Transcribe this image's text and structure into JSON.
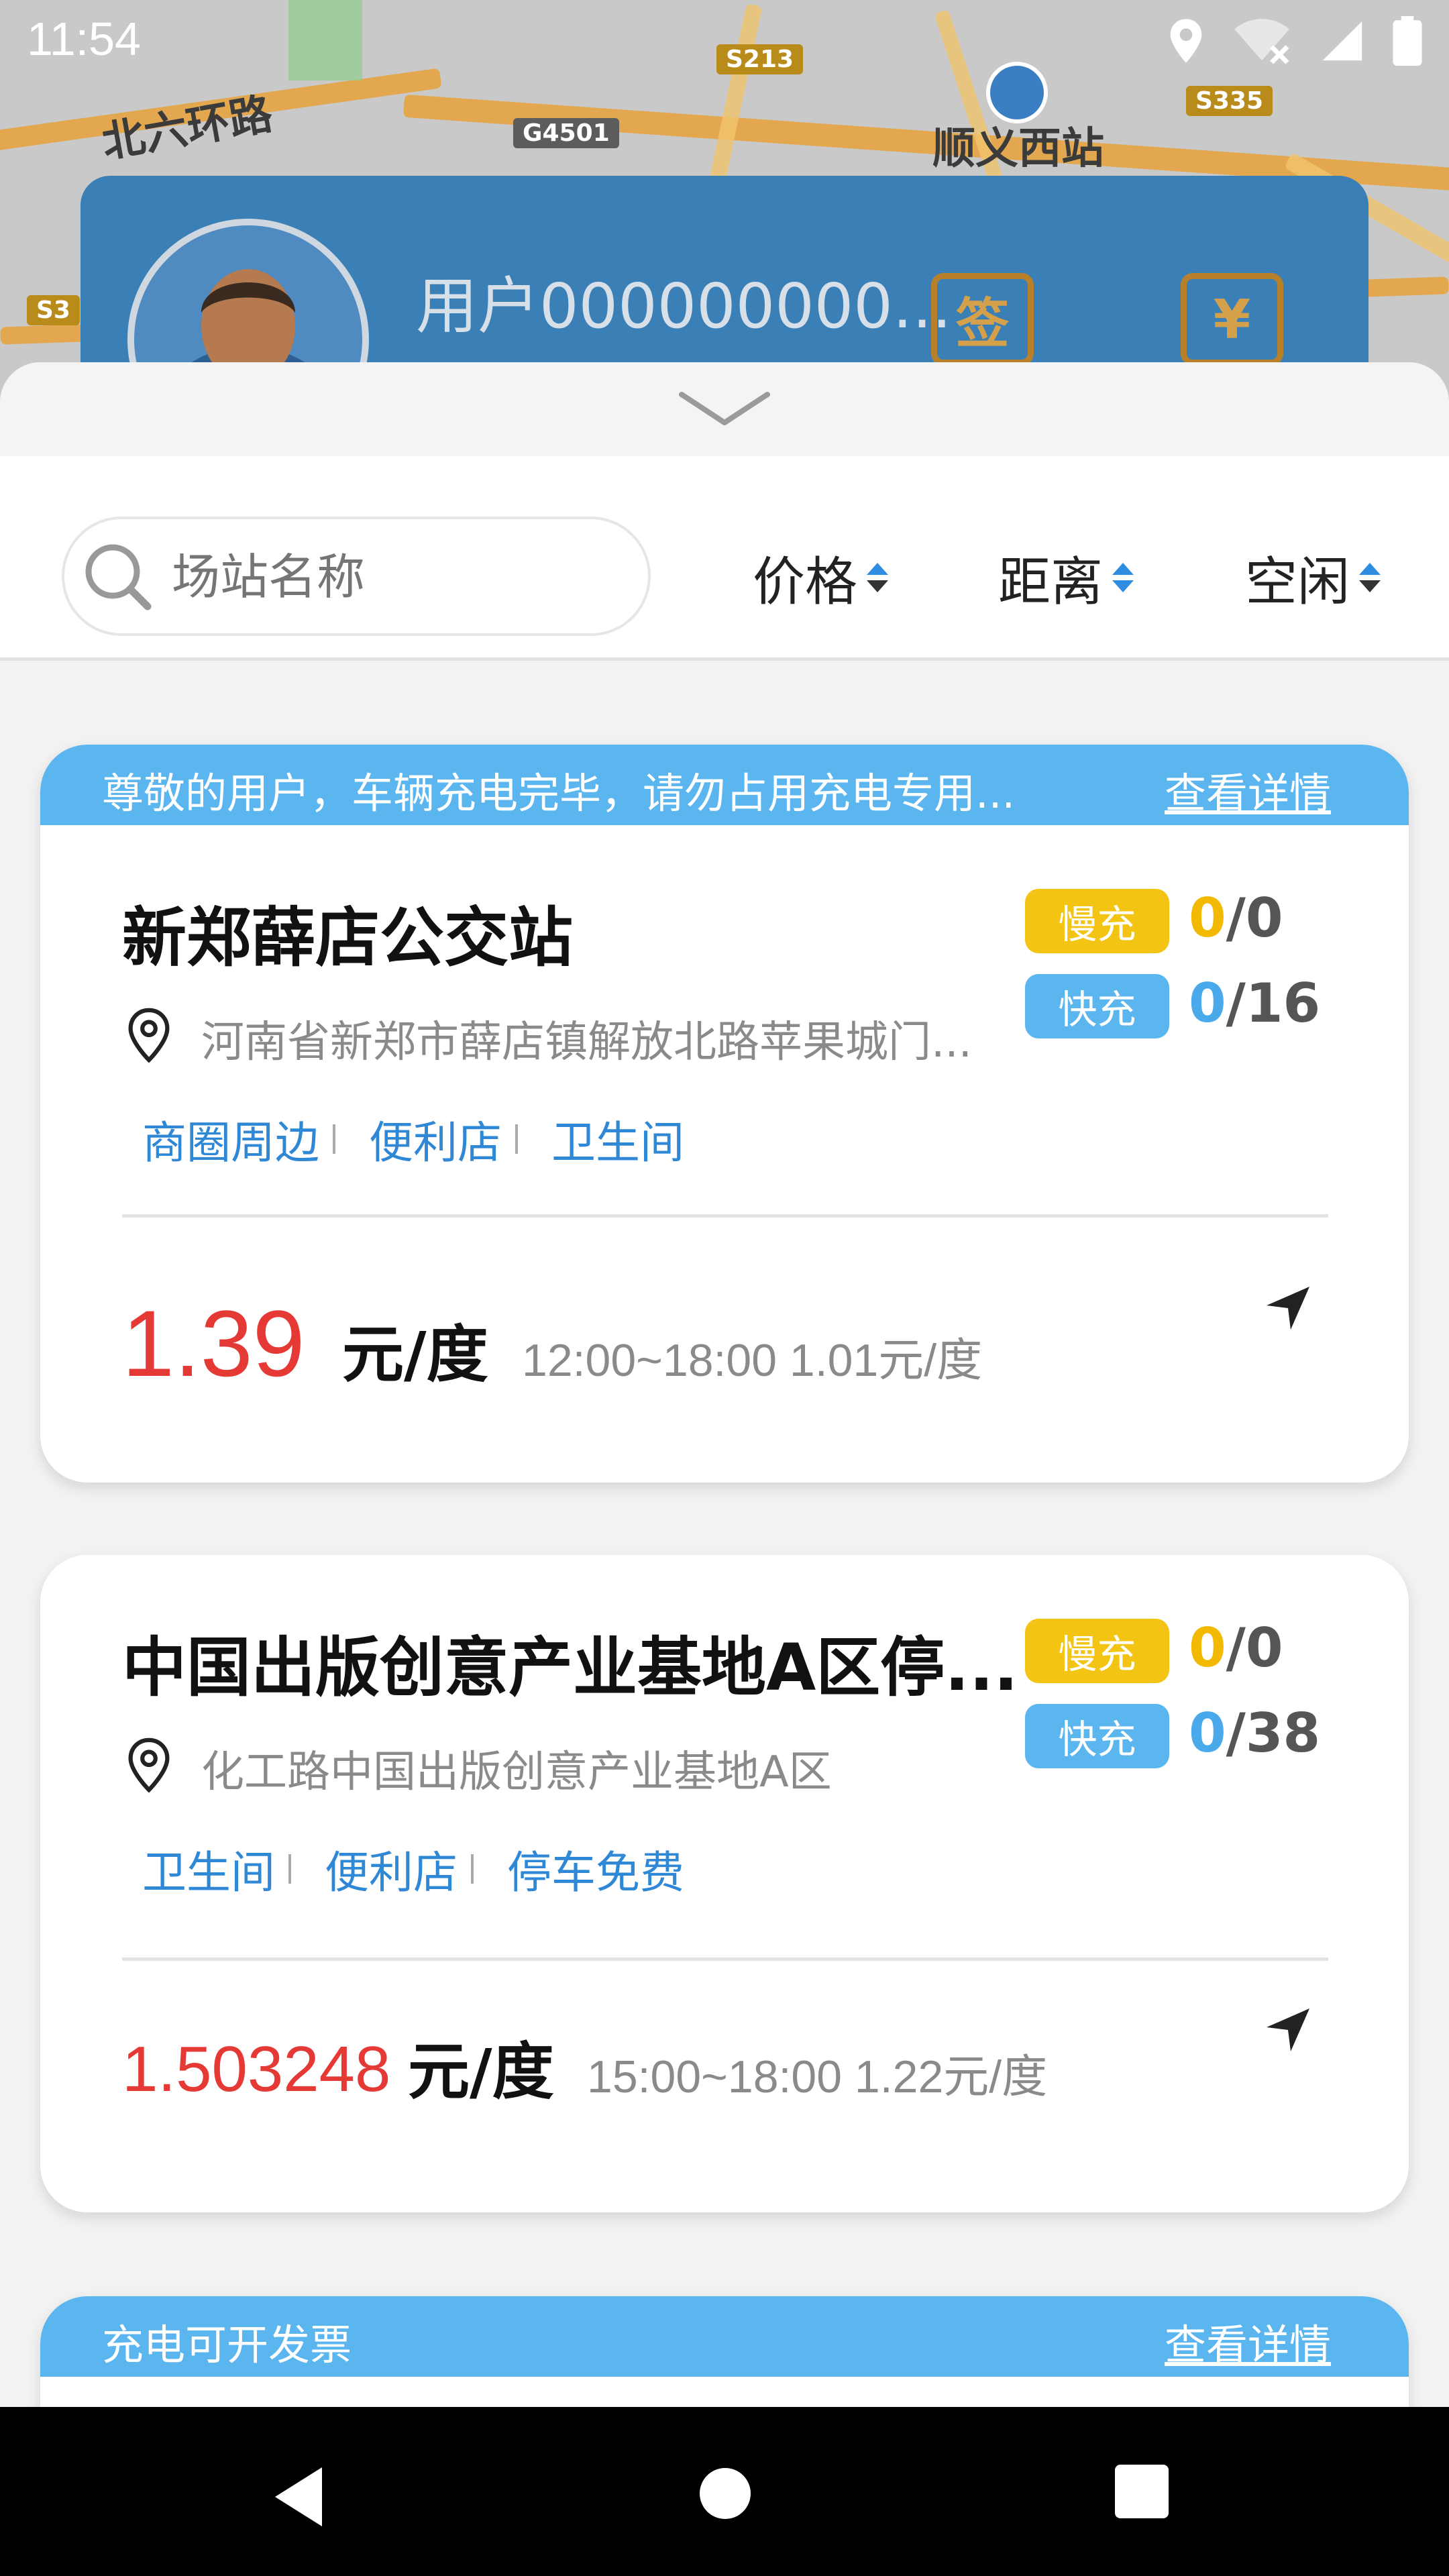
{
  "status_bar": {
    "time": "11:54"
  },
  "map": {
    "labels": [
      "北六环路",
      "顺义西站"
    ],
    "highways": [
      "S213",
      "G4501",
      "S335",
      "S3"
    ]
  },
  "user_card": {
    "username": "用户000000000...",
    "sign_icon": "签",
    "wallet_icon": "¥"
  },
  "filters": {
    "search_placeholder": "场站名称",
    "sort_price": "价格",
    "sort_distance": "距离",
    "sort_idle": "空闲"
  },
  "stations": [
    {
      "notice": "尊敬的用户，车辆充电完毕，请勿占用充电专用...",
      "notice_link": "查看详情",
      "name": "新郑薛店公交站",
      "address": "河南省新郑市薛店镇解放北路苹果城门...",
      "tags": [
        "商圈周边",
        "便利店",
        "卫生间"
      ],
      "slow_label": "慢充",
      "slow_free": "0",
      "slow_total": "/0",
      "fast_label": "快充",
      "fast_free": "0",
      "fast_total": "/16",
      "price": "1.39",
      "unit": "元/度",
      "period": "12:00~18:00 1.01元/度"
    },
    {
      "name": "中国出版创意产业基地A区停...",
      "address": "化工路中国出版创意产业基地A区",
      "tags": [
        "卫生间",
        "便利店",
        "停车免费"
      ],
      "slow_label": "慢充",
      "slow_free": "0",
      "slow_total": "/0",
      "fast_label": "快充",
      "fast_free": "0",
      "fast_total": "/38",
      "price": "1.503248",
      "unit": "元/度",
      "period": "15:00~18:00 1.22元/度"
    },
    {
      "notice": "充电可开发票",
      "notice_link": "查看详情"
    }
  ],
  "colors": {
    "accent_blue": "#5bb5ef",
    "slow_yellow": "#f3c413",
    "price_red": "#e53935"
  }
}
